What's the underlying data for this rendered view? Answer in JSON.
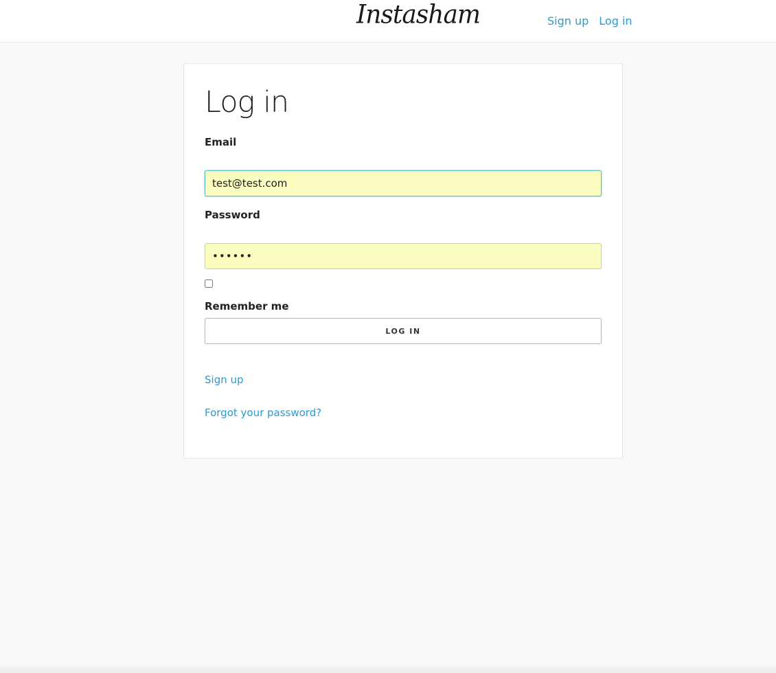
{
  "header": {
    "brand": "Instasham",
    "links": [
      {
        "label": "Sign up"
      },
      {
        "label": "Log in"
      }
    ]
  },
  "form": {
    "title": "Log in",
    "email": {
      "label": "Email",
      "value": "test@test.com"
    },
    "password": {
      "label": "Password",
      "value": "••••••"
    },
    "remember": {
      "label": "Remember me",
      "checked": false
    },
    "submit_label": "LOG IN",
    "links": {
      "sign_up": "Sign up",
      "forgot_password": "Forgot your password?"
    }
  },
  "colors": {
    "link": "#2c9ad1",
    "autofill_bg": "#fafdbf",
    "page_bg": "#f9f9f9"
  }
}
